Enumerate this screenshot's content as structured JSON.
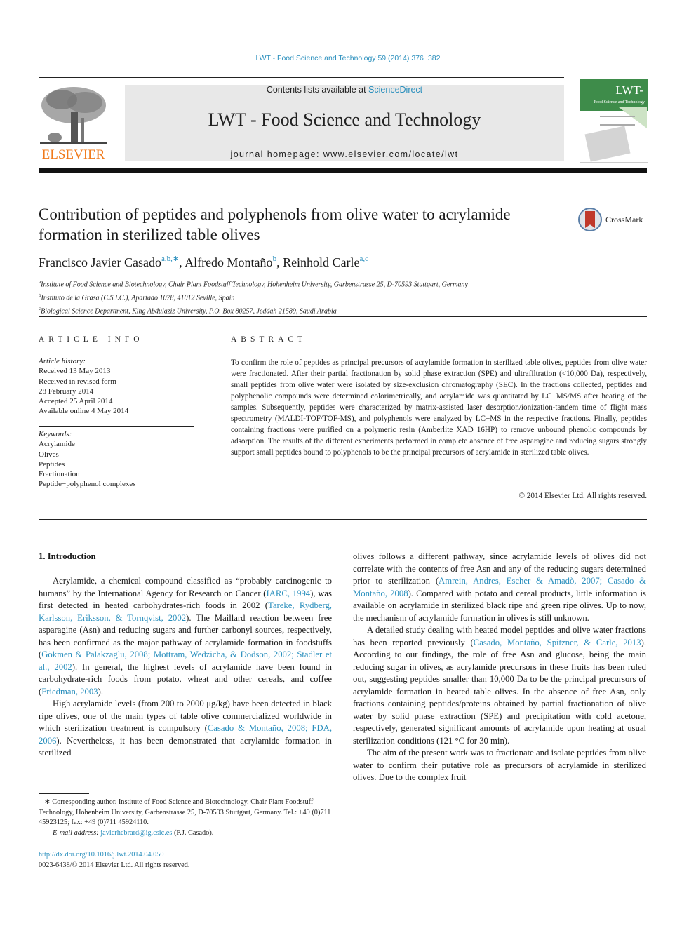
{
  "journal_ref": "LWT - Food Science and Technology 59 (2014) 376−382",
  "header": {
    "contents_prefix": "Contents lists available at ",
    "contents_link": "ScienceDirect",
    "journal_title": "LWT - Food Science and Technology",
    "homepage": "journal homepage: www.elsevier.com/locate/lwt",
    "publisher_logo_text": "ELSEVIER",
    "cover_title": "LWT-",
    "cover_subtitle": "Food Science and Technology"
  },
  "article": {
    "title": "Contribution of peptides and polyphenols from olive water to acrylamide formation in sterilized table olives",
    "crossmark_label": "CrossMark",
    "authors": [
      {
        "name": "Francisco Javier Casado",
        "sup": "a,b,∗"
      },
      {
        "name": "Alfredo Montaño",
        "sup": "b"
      },
      {
        "name": "Reinhold Carle",
        "sup": "a,c"
      }
    ],
    "affiliations": [
      {
        "mark": "a",
        "text": "Institute of Food Science and Biotechnology, Chair Plant Foodstuff Technology, Hohenheim University, Garbenstrasse 25, D-70593 Stuttgart, Germany"
      },
      {
        "mark": "b",
        "text": "Instituto de la Grasa (C.S.I.C.), Apartado 1078, 41012 Seville, Spain"
      },
      {
        "mark": "c",
        "text": "Biological Science Department, King Abdulaziz University, P.O. Box 80257, Jeddah 21589, Saudi Arabia"
      }
    ]
  },
  "article_info": {
    "heading": "ARTICLE INFO",
    "history_label": "Article history:",
    "history": [
      "Received 13 May 2013",
      "Received in revised form",
      "28 February 2014",
      "Accepted 25 April 2014",
      "Available online 4 May 2014"
    ],
    "keywords_label": "Keywords:",
    "keywords": [
      "Acrylamide",
      "Olives",
      "Peptides",
      "Fractionation",
      "Peptide−polyphenol complexes"
    ]
  },
  "abstract": {
    "heading": "ABSTRACT",
    "text": "To confirm the role of peptides as principal precursors of acrylamide formation in sterilized table olives, peptides from olive water were fractionated. After their partial fractionation by solid phase extraction (SPE) and ultrafiltration (<10,000 Da), respectively, small peptides from olive water were isolated by size-exclusion chromatography (SEC). In the fractions collected, peptides and polyphenolic compounds were determined colorimetrically, and acrylamide was quantitated by LC−MS/MS after heating of the samples. Subsequently, peptides were characterized by matrix-assisted laser desorption/ionization-tandem time of flight mass spectrometry (MALDI-TOF/TOF-MS), and polyphenols were analyzed by LC−MS in the respective fractions. Finally, peptides containing fractions were purified on a polymeric resin (Amberlite XAD 16HP) to remove unbound phenolic compounds by adsorption. The results of the different experiments performed in complete absence of free asparagine and reducing sugars strongly support small peptides bound to polyphenols to be the principal precursors of acrylamide in sterilized table olives.",
    "copyright": "© 2014 Elsevier Ltd. All rights reserved."
  },
  "body": {
    "section_heading": "1.  Introduction",
    "left": {
      "p1": [
        {
          "t": "Acrylamide, a chemical compound classified as “probably carcinogenic to humans” by the International Agency for Research on Cancer ("
        },
        {
          "t": "IARC, 1994",
          "link": true
        },
        {
          "t": "), was first detected in heated carbohydrates-rich foods in 2002 ("
        },
        {
          "t": "Tareke, Rydberg, Karlsson, Eriksson, & Tornqvist, 2002",
          "link": true
        },
        {
          "t": "). The Maillard reaction between free asparagine (Asn) and reducing sugars and further carbonyl sources, respectively, has been confirmed as the major pathway of acrylamide formation in foodstuffs ("
        },
        {
          "t": "Gökmen & Palakzaglu, 2008; Mottram, Wedzicha, & Dodson, 2002; Stadler et al., 2002",
          "link": true
        },
        {
          "t": "). In general, the highest levels of acrylamide have been found in carbohydrate-rich foods from potato, wheat and other cereals, and coffee ("
        },
        {
          "t": "Friedman, 2003",
          "link": true
        },
        {
          "t": ")."
        }
      ],
      "p2": [
        {
          "t": "High acrylamide levels (from 200 to 2000 μg/kg) have been detected in black ripe olives, one of the main types of table olive commercialized worldwide in which sterilization treatment is compulsory ("
        },
        {
          "t": "Casado & Montaño, 2008; FDA, 2006",
          "link": true
        },
        {
          "t": "). Nevertheless, it has been demonstrated that acrylamide formation in sterilized"
        }
      ]
    },
    "right": {
      "p1": [
        {
          "t": "olives follows a different pathway, since acrylamide levels of olives did not correlate with the contents of free Asn and any of the reducing sugars determined prior to sterilization ("
        },
        {
          "t": "Amrein, Andres, Escher & Amadò, 2007; Casado & Montaño, 2008",
          "link": true
        },
        {
          "t": "). Compared with potato and cereal products, little information is available on acrylamide in sterilized black ripe and green ripe olives. Up to now, the mechanism of acrylamide formation in olives is still unknown."
        }
      ],
      "p2": [
        {
          "t": "A detailed study dealing with heated model peptides and olive water fractions has been reported previously ("
        },
        {
          "t": "Casado, Montaño, Spitzner, & Carle, 2013",
          "link": true
        },
        {
          "t": "). According to our findings, the role of free Asn and glucose, being the main reducing sugar in olives, as acrylamide precursors in these fruits has been ruled out, suggesting peptides smaller than 10,000 Da to be the principal precursors of acrylamide formation in heated table olives. In the absence of free Asn, only fractions containing peptides/proteins obtained by partial fractionation of olive water by solid phase extraction (SPE) and precipitation with cold acetone, respectively, generated significant amounts of acrylamide upon heating at usual sterilization conditions (121 °C for 30 min)."
        }
      ],
      "p3": [
        {
          "t": "The aim of the present work was to fractionate and isolate peptides from olive water to confirm their putative role as precursors of acrylamide in sterilized olives. Due to the complex fruit"
        }
      ]
    }
  },
  "footnote": {
    "corresponding": "∗  Corresponding author. Institute of Food Science and Biotechnology, Chair Plant Foodstuff Technology, Hohenheim University, Garbenstrasse 25, D-70593 Stuttgart, Germany. Tel.: +49 (0)711 45923125; fax: +49 (0)711 45924110.",
    "email_label": "E-mail address: ",
    "email": "javierhebrard@ig.csic.es",
    "email_suffix": " (F.J. Casado).",
    "doi": "http://dx.doi.org/10.1016/j.lwt.2014.04.050",
    "issn": "0023-6438/© 2014 Elsevier Ltd. All rights reserved."
  },
  "colors": {
    "link": "#2a8fbd",
    "elsevier_orange": "#f07a1b",
    "banner_gray": "#e8e8e8",
    "cover_green": "#3e8c4a"
  }
}
